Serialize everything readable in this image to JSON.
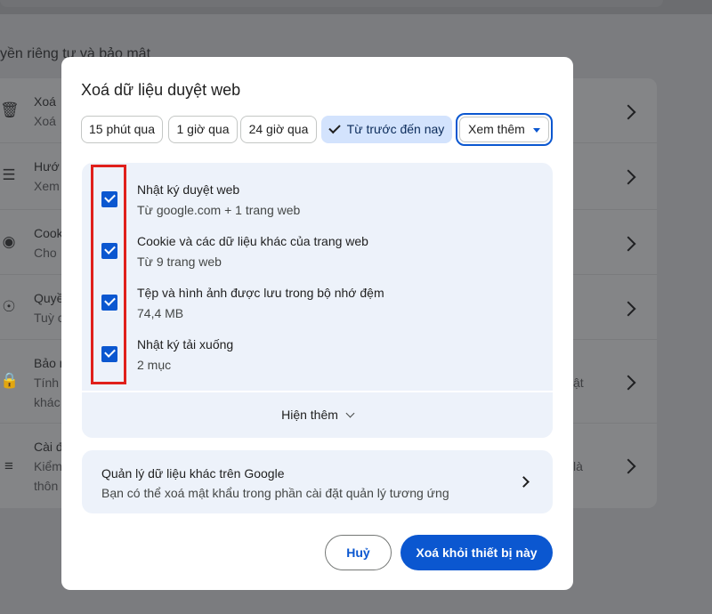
{
  "background": {
    "section_title": "yền riêng tư và bảo mật",
    "rows": [
      {
        "icon": "trash-icon",
        "line1": "Xoá",
        "line2": "Xoá",
        "right": ""
      },
      {
        "icon": "tune-icon",
        "line1": "Hướ",
        "line2": "Xem",
        "right": ""
      },
      {
        "icon": "cookie-icon",
        "line1": "Cook",
        "line2": "Cho",
        "right": ""
      },
      {
        "icon": "permissions-icon",
        "line1": "Quyề",
        "line2": "Tuỳ c",
        "right": ""
      },
      {
        "icon": "lock-icon",
        "line1": "Bảo m",
        "line2": "Tính",
        "line3": "khác",
        "right": "ật"
      },
      {
        "icon": "settings-sliders-icon",
        "line1": "Cài đ",
        "line2": "Kiểm",
        "line3": "thôn",
        "right": "là"
      }
    ]
  },
  "dialog": {
    "title": "Xoá dữ liệu duyệt web",
    "time_ranges": [
      {
        "label": "15 phút qua",
        "selected": false
      },
      {
        "label": "1 giờ qua",
        "selected": false
      },
      {
        "label": "24 giờ qua",
        "selected": false
      },
      {
        "label": "Từ trước đến nay",
        "selected": true
      }
    ],
    "more_select": "Xem thêm",
    "items": [
      {
        "title": "Nhật ký duyệt web",
        "subtitle": "Từ google.com + 1 trang web",
        "checked": true
      },
      {
        "title": "Cookie và các dữ liệu khác của trang web",
        "subtitle": "Từ 9 trang web",
        "checked": true
      },
      {
        "title": "Tệp và hình ảnh được lưu trong bộ nhớ đệm",
        "subtitle": "74,4 MB",
        "checked": true
      },
      {
        "title": "Nhật ký tải xuống",
        "subtitle": "2 mục",
        "checked": true
      }
    ],
    "show_more": "Hiện thêm",
    "google_box": {
      "title": "Quản lý dữ liệu khác trên Google",
      "subtitle": "Bạn có thể xoá mật khẩu trong phần cài đặt quản lý tương ứng"
    },
    "cancel_label": "Huỷ",
    "clear_label": "Xoá khỏi thiết bị này"
  },
  "colors": {
    "accent": "#0b57d0",
    "chip_selected": "#d3e3fd",
    "panel": "#edf2fa",
    "highlight": "#e0201b"
  }
}
